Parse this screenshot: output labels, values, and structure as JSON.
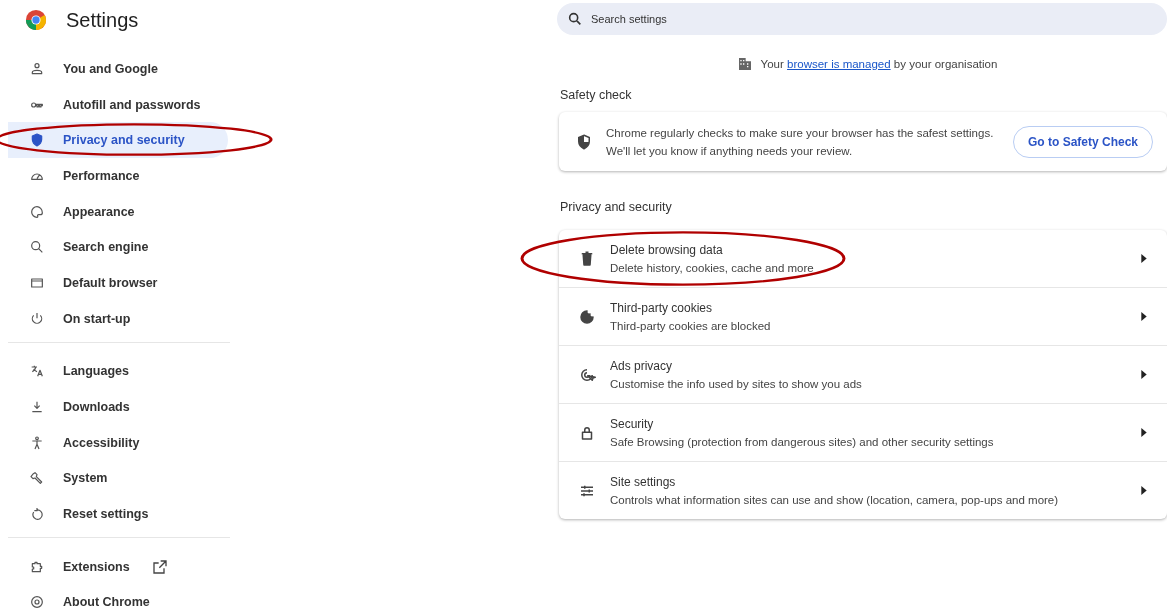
{
  "header": {
    "title": "Settings"
  },
  "sidebar": {
    "groups": [
      {
        "items": [
          {
            "label": "You and Google",
            "selected": false,
            "circled": false
          },
          {
            "label": "Autofill and passwords",
            "selected": false,
            "circled": false
          },
          {
            "label": "Privacy and security",
            "selected": true,
            "circled": true
          },
          {
            "label": "Performance",
            "selected": false,
            "circled": false
          },
          {
            "label": "Appearance",
            "selected": false,
            "circled": false
          },
          {
            "label": "Search engine",
            "selected": false,
            "circled": false
          },
          {
            "label": "Default browser",
            "selected": false,
            "circled": false
          },
          {
            "label": "On start-up",
            "selected": false,
            "circled": false
          }
        ]
      },
      {
        "items": [
          {
            "label": "Languages",
            "selected": false,
            "circled": false
          },
          {
            "label": "Downloads",
            "selected": false,
            "circled": false
          },
          {
            "label": "Accessibility",
            "selected": false,
            "circled": false
          },
          {
            "label": "System",
            "selected": false,
            "circled": false
          },
          {
            "label": "Reset settings",
            "selected": false,
            "circled": false
          }
        ]
      },
      {
        "items": [
          {
            "label": "Extensions",
            "selected": false,
            "circled": false,
            "external": true
          },
          {
            "label": "About Chrome",
            "selected": false,
            "circled": false,
            "external": false
          }
        ]
      }
    ]
  },
  "search": {
    "placeholder": "Search settings"
  },
  "managed_notice": {
    "before": "Your",
    "link": "browser is managed",
    "after": "by your organisation"
  },
  "safety_check": {
    "heading": "Safety check",
    "lines": [
      "Chrome regularly checks to make sure your browser has the safest settings.",
      "We'll let you know if anything needs your review."
    ],
    "button": "Go to Safety Check"
  },
  "privacy": {
    "heading": "Privacy and security",
    "rows": [
      {
        "title": "Delete browsing data",
        "subtitle": "Delete history, cookies, cache and more",
        "circled": true
      },
      {
        "title": "Third-party cookies",
        "subtitle": "Third-party cookies are blocked",
        "circled": false
      },
      {
        "title": "Ads privacy",
        "subtitle": "Customise the info used by sites to show you ads",
        "circled": false
      },
      {
        "title": "Security",
        "subtitle": "Safe Browsing (protection from dangerous sites) and other security settings",
        "circled": false
      },
      {
        "title": "Site settings",
        "subtitle": "Controls what information sites can use and show (location, camera, pop-ups and more)",
        "circled": false
      }
    ]
  }
}
